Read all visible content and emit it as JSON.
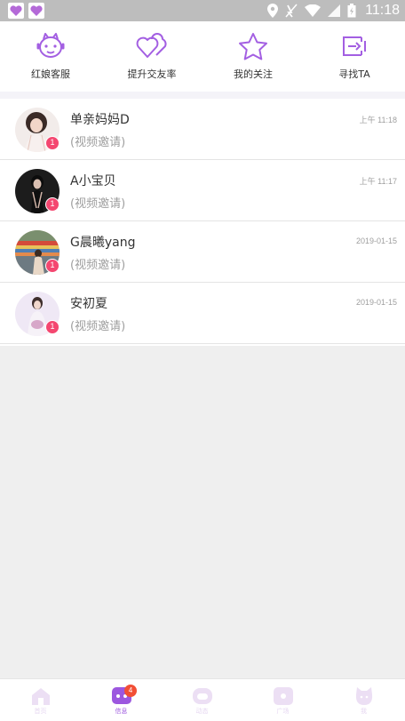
{
  "status_bar": {
    "time": "11:18",
    "icons": [
      "location-icon",
      "no-data-icon",
      "wifi-icon",
      "signal-icon",
      "battery-icon"
    ]
  },
  "quick_actions": [
    {
      "label": "红娘客服",
      "icon": "customer-service-icon"
    },
    {
      "label": "提升交友率",
      "icon": "hearts-icon"
    },
    {
      "label": "我的关注",
      "icon": "star-icon"
    },
    {
      "label": "寻找TA",
      "icon": "search-person-icon"
    }
  ],
  "conversations": [
    {
      "name": "单亲妈妈D",
      "message": "(视频邀请)",
      "time": "上午 11:18",
      "unread": "1"
    },
    {
      "name": "A小宝贝",
      "message": "(视频邀请)",
      "time": "上午 11:17",
      "unread": "1"
    },
    {
      "name": "G晨曦yang",
      "message": "(视频邀请)",
      "time": "2019-01-15",
      "unread": "1"
    },
    {
      "name": "安初夏",
      "message": "(视频邀请)",
      "time": "2019-01-15",
      "unread": "1"
    }
  ],
  "tabs": [
    {
      "label": "首页",
      "icon": "home-icon",
      "active": false
    },
    {
      "label": "信息",
      "icon": "message-icon",
      "active": true,
      "badge": "4"
    },
    {
      "label": "动态",
      "icon": "moments-icon",
      "active": false
    },
    {
      "label": "广场",
      "icon": "square-icon",
      "active": false
    },
    {
      "label": "我",
      "icon": "profile-icon",
      "active": false
    }
  ],
  "colors": {
    "accent": "#9c57df",
    "badge_red": "#f44770",
    "tab_badge": "#f24f35",
    "status_bar": "#bdbdbd"
  }
}
